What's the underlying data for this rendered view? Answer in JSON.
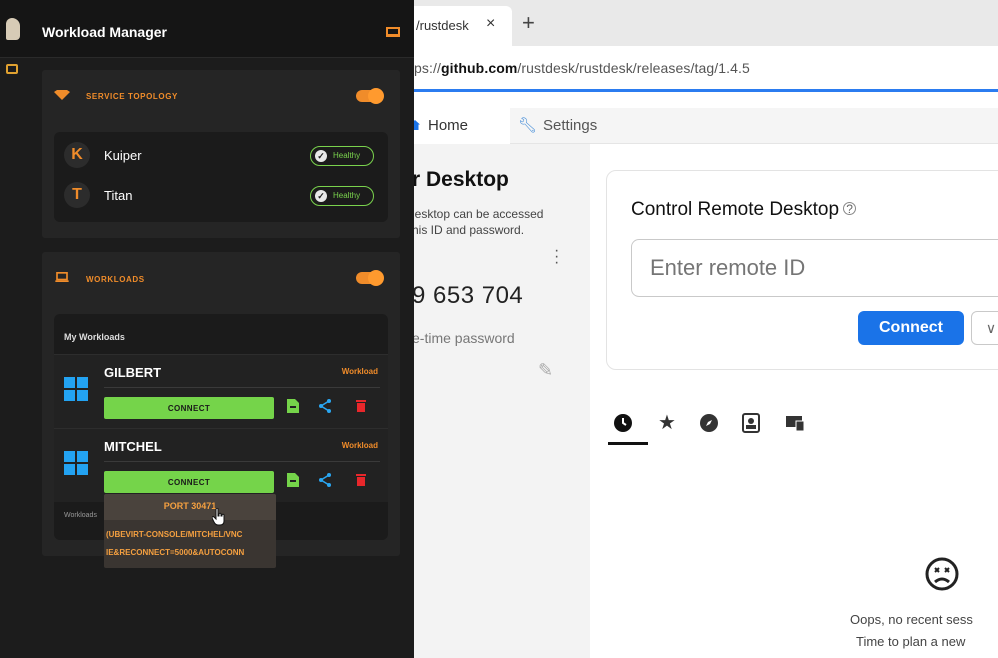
{
  "browser": {
    "tab_title": "/rustdesk",
    "tab_close": "×",
    "new_tab": "+",
    "url_prefix": "ps://",
    "url_host": "github.com",
    "url_path": "/rustdesk/rustdesk/releases/tag/1.4.5"
  },
  "rustdesk": {
    "tabs": {
      "home": "Home",
      "settings": "Settings"
    },
    "left": {
      "title": "r Desktop",
      "desc_line1": "lesktop can be accessed",
      "desc_line2": "his ID and password.",
      "id": "9 653 704",
      "password_label": "e-time password"
    },
    "control": {
      "title": "Control Remote Desktop",
      "help": "?",
      "input_placeholder": "Enter remote ID",
      "connect_label": "Connect",
      "more_label": "∨"
    },
    "icons": [
      "recent-clock-icon",
      "favorites-star-icon",
      "discover-compass-icon",
      "address-book-icon",
      "group-devices-icon"
    ],
    "empty_line1": "Oops, no recent sess",
    "empty_line2": "Time to plan a new"
  },
  "panel": {
    "title": "Workload Manager",
    "service_topology": {
      "label": "SERVICE TOPOLOGY",
      "toggle_on": true,
      "services": [
        {
          "badge": "K",
          "name": "Kuiper",
          "status": "Healthy"
        },
        {
          "badge": "T",
          "name": "Titan",
          "status": "Healthy"
        }
      ]
    },
    "workloads": {
      "label": "WORKLOADS",
      "toggle_on": true,
      "my_label": "My Workloads",
      "items": [
        {
          "name": "GILBERT",
          "tag": "Workload",
          "connect": "CONNECT"
        },
        {
          "name": "MITCHEL",
          "tag": "Workload",
          "connect": "CONNECT"
        }
      ],
      "footer": "Workloads"
    },
    "popup": {
      "port": "PORT 30471",
      "url_line1": "(UBEVIRT-CONSOLE/MITCHEL/VNC",
      "url_line2": "IE&RECONNECT=5000&AUTOCONN"
    }
  }
}
